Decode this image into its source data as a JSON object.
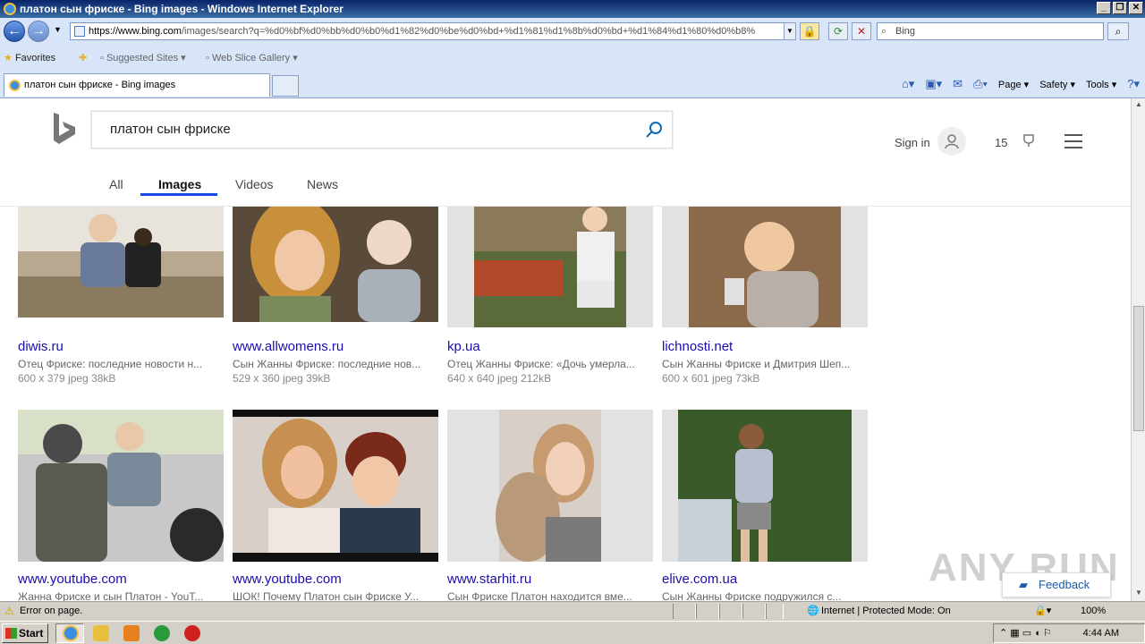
{
  "window": {
    "title": "платон сын фриске - Bing images - Windows Internet Explorer"
  },
  "browser": {
    "url_domain": "https://www.bing.com",
    "url_rest": "/images/search?q=%d0%bf%d0%bb%d0%b0%d1%82%d0%be%d0%bd+%d1%81%d1%8b%d0%bd+%d1%84%d1%80%d0%b8%",
    "search_placeholder": "Bing",
    "favorites_label": "Favorites",
    "suggested_sites_label": "Suggested Sites",
    "web_slice_label": "Web Slice Gallery",
    "tab_title": "платон сын фриске - Bing images",
    "cmd_page": "Page",
    "cmd_safety": "Safety",
    "cmd_tools": "Tools"
  },
  "bing": {
    "query": "платон сын фриске",
    "sign_in": "Sign in",
    "rewards_count": "15",
    "scopes": [
      "All",
      "Images",
      "Videos",
      "News"
    ],
    "active_scope": "Images"
  },
  "results": [
    {
      "source": "diwis.ru",
      "desc": "Отец Фриске: последние новости н...",
      "meta": "600 x 379 jpeg 38kB"
    },
    {
      "source": "www.allwomens.ru",
      "desc": "Сын Жанны Фриске: последние нов...",
      "meta": "529 x 360 jpeg 39kB"
    },
    {
      "source": "kp.ua",
      "desc": "Отец Жанны Фриске: «Дочь умерла...",
      "meta": "640 x 640 jpeg 212kB"
    },
    {
      "source": "lichnosti.net",
      "desc": "Сын Жанны Фриске и Дмитрия Шеп...",
      "meta": "600 x 601 jpeg 73kB"
    },
    {
      "source": "www.youtube.com",
      "desc": "Жанна Фриске и сын Платон - YouT...",
      "meta": ""
    },
    {
      "source": "www.youtube.com",
      "desc": "ШОК! Почему Платон сын Фриске У...",
      "meta": ""
    },
    {
      "source": "www.starhit.ru",
      "desc": "Сын Фриске Платон находится вме...",
      "meta": ""
    },
    {
      "source": "elive.com.ua",
      "desc": "Сын Жанны Фриске подружился с...",
      "meta": ""
    }
  ],
  "feedback_label": "Feedback",
  "watermark": "ANY RUN",
  "status": {
    "error_text": "Error on page.",
    "zone_text": "Internet | Protected Mode: On",
    "zoom_text": "100%"
  },
  "taskbar": {
    "start_label": "Start",
    "clock": "4:44 AM"
  }
}
